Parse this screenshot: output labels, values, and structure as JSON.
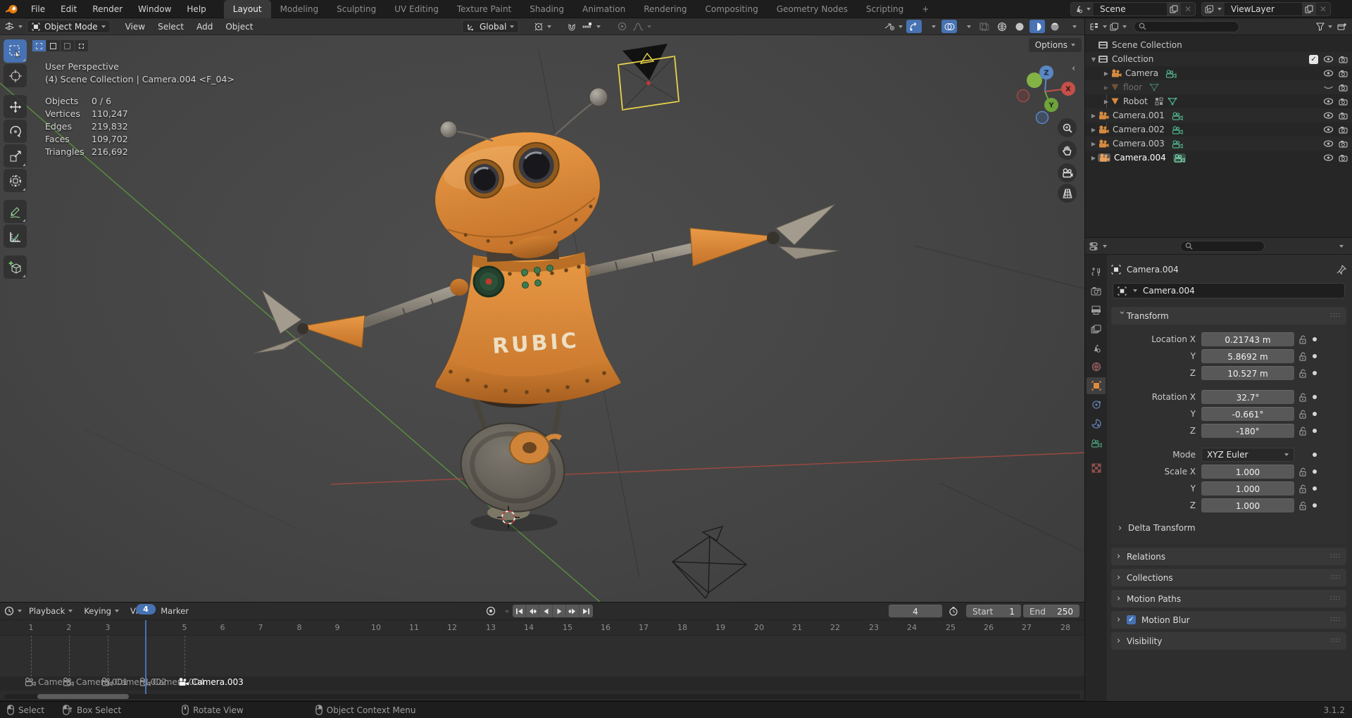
{
  "topbar": {
    "menus": [
      {
        "label": "File"
      },
      {
        "label": "Edit"
      },
      {
        "label": "Render"
      },
      {
        "label": "Window"
      },
      {
        "label": "Help"
      }
    ],
    "tabs": [
      {
        "label": "Layout"
      },
      {
        "label": "Modeling"
      },
      {
        "label": "Sculpting"
      },
      {
        "label": "UV Editing"
      },
      {
        "label": "Texture Paint"
      },
      {
        "label": "Shading"
      },
      {
        "label": "Animation"
      },
      {
        "label": "Rendering"
      },
      {
        "label": "Compositing"
      },
      {
        "label": "Geometry Nodes"
      },
      {
        "label": "Scripting"
      }
    ],
    "add_tab_label": "+",
    "scene_selector": {
      "value": "Scene"
    },
    "view_layer_selector": {
      "value": "ViewLayer"
    }
  },
  "viewport": {
    "header": {
      "mode": "Object Mode",
      "menus": [
        {
          "label": "View"
        },
        {
          "label": "Select"
        },
        {
          "label": "Add"
        },
        {
          "label": "Object"
        }
      ],
      "orientation": "Global"
    },
    "options_button": "Options",
    "overlay": {
      "view_name": "User Perspective",
      "context": "(4) Scene Collection | Camera.004 <F_04>",
      "stats": [
        {
          "label": "Objects",
          "value": "0 / 6"
        },
        {
          "label": "Vertices",
          "value": "110,247"
        },
        {
          "label": "Edges",
          "value": "219,832"
        },
        {
          "label": "Faces",
          "value": "109,702"
        },
        {
          "label": "Triangles",
          "value": "216,692"
        }
      ]
    },
    "gizmo": {
      "x": "X",
      "y": "Y",
      "z": "Z"
    },
    "scene_objects": {
      "robot_text": "RUBIC"
    }
  },
  "outliner": {
    "items": [
      {
        "label": "Scene Collection"
      },
      {
        "label": "Collection"
      },
      {
        "label": "Camera"
      },
      {
        "label": "floor"
      },
      {
        "label": "Robot"
      },
      {
        "label": "Camera.001"
      },
      {
        "label": "Camera.002"
      },
      {
        "label": "Camera.003"
      },
      {
        "label": "Camera.004"
      }
    ]
  },
  "properties": {
    "breadcrumb": "Camera.004",
    "name_field": "Camera.004",
    "transform": {
      "title": "Transform",
      "location_rows": [
        {
          "label": "Location X",
          "value": "0.21743 m"
        },
        {
          "label": "Y",
          "value": "5.8692 m"
        },
        {
          "label": "Z",
          "value": "10.527 m"
        }
      ],
      "rotation_rows": [
        {
          "label": "Rotation X",
          "value": "32.7°"
        },
        {
          "label": "Y",
          "value": "-0.661°"
        },
        {
          "label": "Z",
          "value": "-180°"
        }
      ],
      "mode_label": "Mode",
      "mode_value": "XYZ Euler",
      "scale_rows": [
        {
          "label": "Scale X",
          "value": "1.000"
        },
        {
          "label": "Y",
          "value": "1.000"
        },
        {
          "label": "Z",
          "value": "1.000"
        }
      ],
      "subpanel": "Delta Transform"
    },
    "panels": [
      {
        "title": "Relations"
      },
      {
        "title": "Collections"
      },
      {
        "title": "Motion Paths"
      },
      {
        "title": "Motion Blur"
      },
      {
        "title": "Visibility"
      }
    ]
  },
  "timeline": {
    "menus": [
      {
        "label": "Playback"
      },
      {
        "label": "Keying"
      },
      {
        "label": "View"
      },
      {
        "label": "Marker"
      }
    ],
    "current_frame": "4",
    "start": {
      "label": "Start",
      "value": "1"
    },
    "end": {
      "label": "End",
      "value": "250"
    },
    "ruler": [
      "1",
      "2",
      "3",
      "4",
      "5",
      "6",
      "7",
      "8",
      "9",
      "10",
      "11",
      "12",
      "13",
      "14",
      "15",
      "16",
      "17",
      "18",
      "19",
      "20",
      "21",
      "22",
      "23",
      "24",
      "25",
      "26",
      "27",
      "28"
    ],
    "markers": [
      {
        "label": "Camera"
      },
      {
        "label": "Camera.001"
      },
      {
        "label": "Camera.002"
      },
      {
        "label": "Camera.004"
      },
      {
        "label": "Camera.003"
      }
    ]
  },
  "statusbar": {
    "hints": [
      {
        "label": "Select"
      },
      {
        "label": "Box Select"
      },
      {
        "label": "Rotate View"
      },
      {
        "label": "Object Context Menu"
      }
    ],
    "version": "3.1.2"
  },
  "colors": {
    "accent_blue": "#4772b3",
    "selection_yellow": "#e8d44d",
    "object_orange": "#e08a3c",
    "axis_green": "#5c9e3c",
    "axis_red": "#b34a3f"
  }
}
